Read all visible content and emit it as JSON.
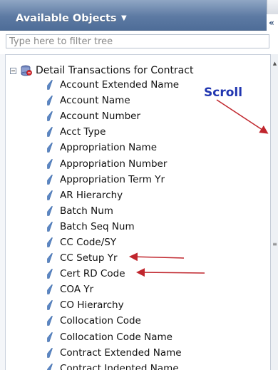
{
  "panel": {
    "title": "Available Objects",
    "title_caret": "▼",
    "collapse_glyph": "«"
  },
  "filter": {
    "placeholder": "Type here to filter tree",
    "value": ""
  },
  "tree": {
    "root_label": "Detail Transactions for Contract",
    "items": [
      {
        "label": "Account Extended Name"
      },
      {
        "label": "Account Name"
      },
      {
        "label": "Account Number"
      },
      {
        "label": "Acct Type"
      },
      {
        "label": "Appropriation Name"
      },
      {
        "label": "Appropriation Number"
      },
      {
        "label": "Appropriation Term Yr"
      },
      {
        "label": "AR Hierarchy"
      },
      {
        "label": "Batch Num"
      },
      {
        "label": "Batch Seq Num"
      },
      {
        "label": "CC Code/SY"
      },
      {
        "label": "CC Setup Yr"
      },
      {
        "label": "Cert RD Code"
      },
      {
        "label": "COA Yr"
      },
      {
        "label": "CO Hierarchy"
      },
      {
        "label": "Collocation Code"
      },
      {
        "label": "Collocation Code Name"
      },
      {
        "label": "Contract Extended Name"
      },
      {
        "label": "Contract Indented Name"
      }
    ]
  },
  "annotation": {
    "text": "Scroll",
    "color": "#2136b0",
    "arrow_color": "#c0262d"
  },
  "colors": {
    "header": "#5d7aa3",
    "leaf_icon": "#5b86c4"
  },
  "icons": {
    "expander": "minus-box-icon",
    "root": "database-icon",
    "leaf": "dimension-icon"
  }
}
